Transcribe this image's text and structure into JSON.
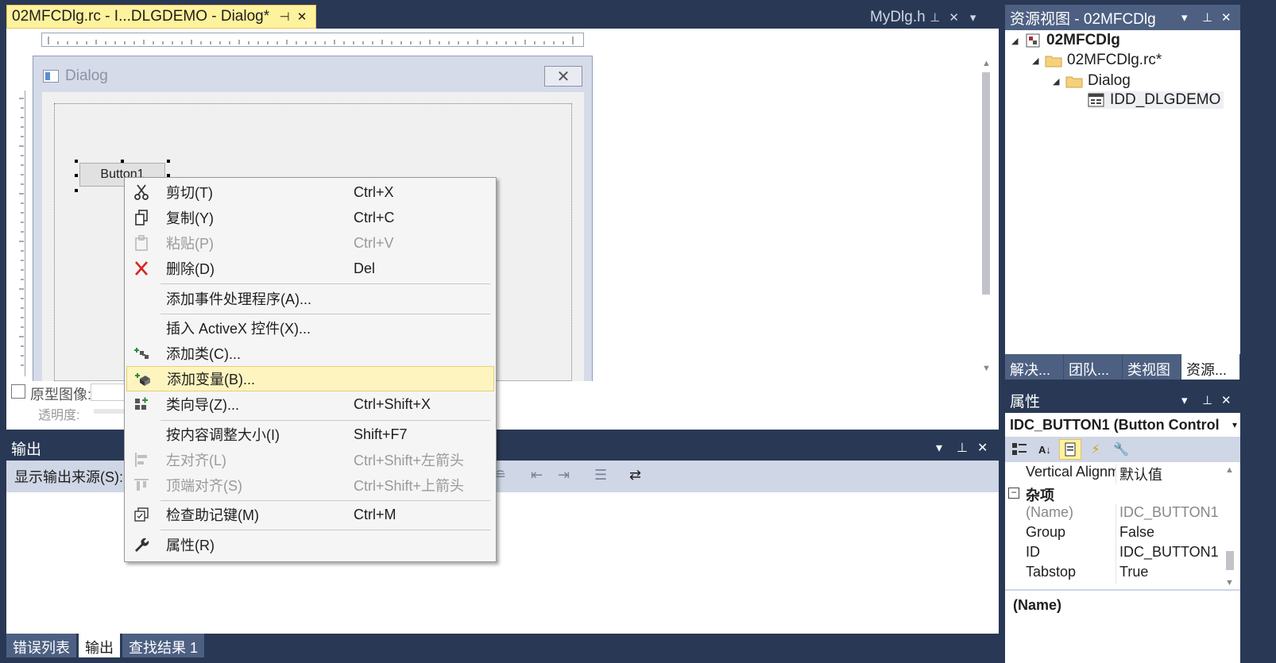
{
  "doc_tabs": {
    "active": {
      "title": "02MFCDlg.rc - I...DLGDEMO - Dialog*",
      "pin_icon": "pin-icon",
      "close_icon": "close-icon"
    },
    "other": {
      "title": "MyDlg.h"
    }
  },
  "dialog": {
    "title": "Dialog",
    "close_glyph": "✕",
    "button_label": "Button1"
  },
  "prototype": {
    "label": "原型图像:",
    "opacity_label": "透明度:"
  },
  "context_menu": {
    "items": [
      {
        "label": "剪切(T)",
        "shortcut": "Ctrl+X",
        "icon": "cut-icon",
        "enabled": true
      },
      {
        "label": "复制(Y)",
        "shortcut": "Ctrl+C",
        "icon": "copy-icon",
        "enabled": true
      },
      {
        "label": "粘贴(P)",
        "shortcut": "Ctrl+V",
        "icon": "paste-icon",
        "enabled": false
      },
      {
        "label": "删除(D)",
        "shortcut": "Del",
        "icon": "delete-icon",
        "enabled": true
      },
      {
        "label": "添加事件处理程序(A)...",
        "shortcut": "",
        "icon": "",
        "enabled": true
      },
      {
        "label": "插入 ActiveX 控件(X)...",
        "shortcut": "",
        "icon": "",
        "enabled": true
      },
      {
        "label": "添加类(C)...",
        "shortcut": "",
        "icon": "add-class-icon",
        "enabled": true
      },
      {
        "label": "添加变量(B)...",
        "shortcut": "",
        "icon": "add-variable-icon",
        "enabled": true,
        "highlighted": true
      },
      {
        "label": "类向导(Z)...",
        "shortcut": "Ctrl+Shift+X",
        "icon": "class-wizard-icon",
        "enabled": true
      },
      {
        "label": "按内容调整大小(I)",
        "shortcut": "Shift+F7",
        "icon": "",
        "enabled": true
      },
      {
        "label": "左对齐(L)",
        "shortcut": "Ctrl+Shift+左箭头",
        "icon": "align-left-icon",
        "enabled": false
      },
      {
        "label": "顶端对齐(S)",
        "shortcut": "Ctrl+Shift+上箭头",
        "icon": "align-top-icon",
        "enabled": false
      },
      {
        "label": "检查助记键(M)",
        "shortcut": "Ctrl+M",
        "icon": "check-mnemonics-icon",
        "enabled": true
      },
      {
        "label": "属性(R)",
        "shortcut": "",
        "icon": "properties-wrench-icon",
        "enabled": true
      }
    ]
  },
  "output": {
    "title": "输出",
    "source_label": "显示输出来源(S):"
  },
  "bottom_tabs": [
    {
      "label": "错误列表",
      "active": false
    },
    {
      "label": "输出",
      "active": true
    },
    {
      "label": "查找结果 1",
      "active": false
    }
  ],
  "resource_view": {
    "title": "资源视图 - 02MFCDlg",
    "tree": [
      {
        "label": "02MFCDlg",
        "level": 0,
        "icon": "project-icon",
        "bold": true
      },
      {
        "label": "02MFCDlg.rc*",
        "level": 1,
        "icon": "folder-icon"
      },
      {
        "label": "Dialog",
        "level": 2,
        "icon": "folder-icon"
      },
      {
        "label": "IDD_DLGDEMO",
        "level": 3,
        "icon": "dialog-resource-icon",
        "selected": true
      }
    ],
    "tabs": [
      {
        "label": "解决...",
        "active": false
      },
      {
        "label": "团队...",
        "active": false
      },
      {
        "label": "类视图",
        "active": false
      },
      {
        "label": "资源...",
        "active": true
      }
    ]
  },
  "properties": {
    "title": "属性",
    "object": "IDC_BUTTON1 (Button Control",
    "rows": [
      {
        "key": "Vertical Alignment",
        "value": "默认值"
      },
      {
        "key": "杂项",
        "value": "",
        "category": true
      },
      {
        "key": "(Name)",
        "value": "IDC_BUTTON1",
        "muted": true
      },
      {
        "key": "Group",
        "value": "False"
      },
      {
        "key": "ID",
        "value": "IDC_BUTTON1"
      },
      {
        "key": "Tabstop",
        "value": "True"
      }
    ],
    "description": "(Name)"
  },
  "colors": {
    "chrome": "#293955",
    "active_tab": "#fff29d",
    "menu_highlight": "#fdf4bf"
  }
}
